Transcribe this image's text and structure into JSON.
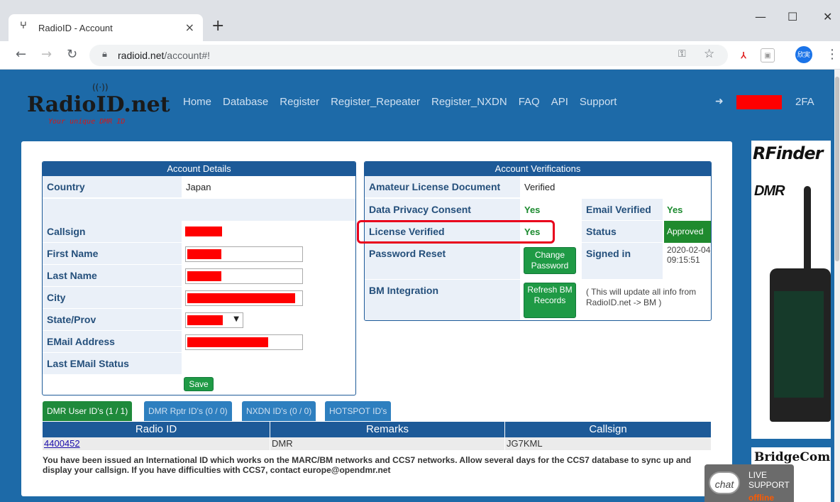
{
  "browser": {
    "tab_title": "RadioID - Account",
    "tab_close": "×",
    "new_tab": "+",
    "url_host": "radioid.net",
    "url_path": "/account#!",
    "profile_initials": "欣実"
  },
  "header": {
    "logo_text": "RadioID.net",
    "logo_tagline": "Your unique DMR ID",
    "nav": [
      "Home",
      "Database",
      "Register",
      "Register_Repeater",
      "Register_NXDN",
      "FAQ",
      "API",
      "Support"
    ],
    "twofa": "2FA"
  },
  "account_details": {
    "title": "Account Details",
    "country_label": "Country",
    "country_value": "Japan",
    "callsign_label": "Callsign",
    "first_name_label": "First Name",
    "last_name_label": "Last Name",
    "city_label": "City",
    "state_label": "State/Prov",
    "email_label": "EMail Address",
    "last_email_status_label": "Last EMail Status",
    "save_label": "Save"
  },
  "account_verifications": {
    "title": "Account Verifications",
    "license_doc_label": "Amateur License Document",
    "license_doc_value": "Verified",
    "privacy_label": "Data Privacy Consent",
    "privacy_value": "Yes",
    "email_verified_label": "Email Verified",
    "email_verified_value": "Yes",
    "license_verified_label": "License Verified",
    "license_verified_value": "Yes",
    "status_label": "Status",
    "status_value": "Approved",
    "password_reset_label": "Password Reset",
    "change_password_label": "Change Password",
    "signed_in_label": "Signed in",
    "signed_in_value": "2020-02-04 09:15:51",
    "bm_label": "BM Integration",
    "refresh_bm_label": "Refresh BM Records",
    "bm_note": "( This will update all info from RadioID.net -> BM )"
  },
  "id_tabs": [
    "DMR User ID's (1 / 1)",
    "DMR Rptr ID's (0 / 0)",
    "NXDN ID's (0 / 0)",
    "HOTSPOT ID's"
  ],
  "id_table": {
    "headers": [
      "Radio ID",
      "Remarks",
      "Callsign"
    ],
    "rows": [
      [
        "4400452",
        "DMR",
        "JG7KML"
      ]
    ]
  },
  "note": "You have been issued an International ID which works on the MARC/BM networks and CCS7 networks. Allow several days for the CCS7 database to sync up and display your callsign. If you have difficulties with CCS7, contact europe@opendmr.net",
  "ads": {
    "rfinder": "RFinder",
    "dmr": "DMR",
    "bridgecom": "BridgeCom"
  },
  "chat": {
    "bubble": "chat",
    "line1": "LIVE",
    "line2": "SUPPORT",
    "status": "offline"
  }
}
